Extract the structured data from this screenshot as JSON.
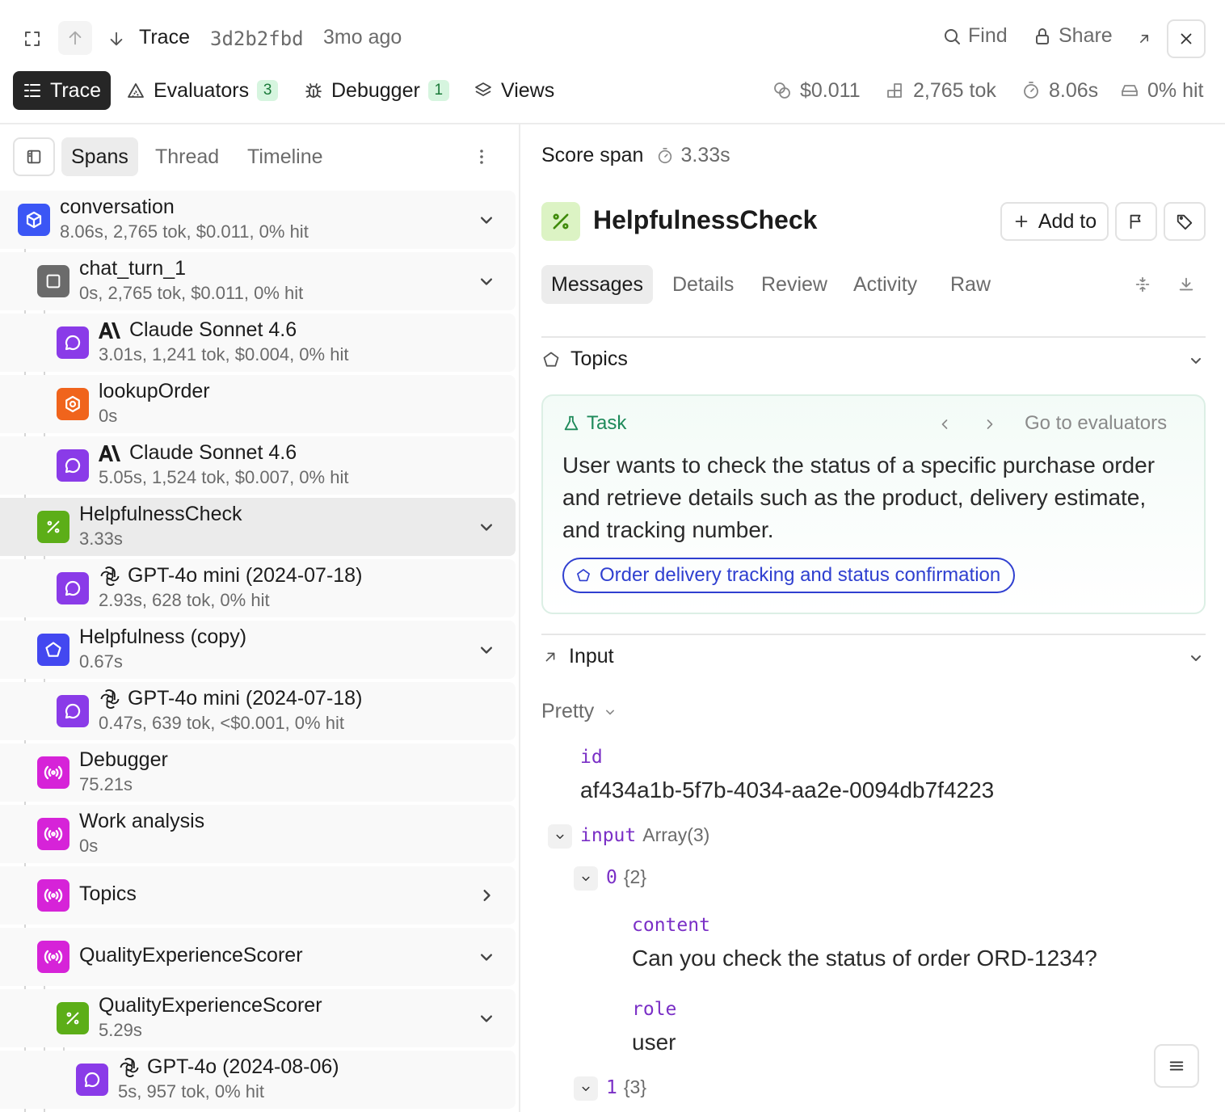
{
  "header": {
    "title": "Trace",
    "trace_id": "3d2b2fbd",
    "age": "3mo ago",
    "find_label": "Find",
    "share_label": "Share"
  },
  "tabs": {
    "trace": "Trace",
    "evaluators": "Evaluators",
    "evaluators_count": "3",
    "debugger": "Debugger",
    "debugger_count": "1",
    "views": "Views"
  },
  "stats": {
    "cost": "$0.011",
    "tokens": "2,765 tok",
    "duration": "8.06s",
    "cache": "0% hit"
  },
  "left_tabs": {
    "spans": "Spans",
    "thread": "Thread",
    "timeline": "Timeline"
  },
  "spans": [
    {
      "name": "conversation",
      "meta": "8.06s, 2,765 tok, $0.011, 0% hit"
    },
    {
      "name": "chat_turn_1",
      "meta": "0s, 2,765 tok, $0.011, 0% hit"
    },
    {
      "name": "Claude Sonnet 4.6",
      "meta": "3.01s, 1,241 tok, $0.004, 0% hit"
    },
    {
      "name": "lookupOrder",
      "meta": "0s"
    },
    {
      "name": "Claude Sonnet 4.6",
      "meta": "5.05s, 1,524 tok, $0.007, 0% hit"
    },
    {
      "name": "HelpfulnessCheck",
      "meta": "3.33s"
    },
    {
      "name": "GPT-4o mini (2024-07-18)",
      "meta": "2.93s, 628 tok, 0% hit"
    },
    {
      "name": "Helpfulness (copy)",
      "meta": "0.67s"
    },
    {
      "name": "GPT-4o mini (2024-07-18)",
      "meta": "0.47s, 639 tok, <$0.001, 0% hit"
    },
    {
      "name": "Debugger",
      "meta": "75.21s"
    },
    {
      "name": "Work analysis",
      "meta": "0s"
    },
    {
      "name": "Topics",
      "meta": ""
    },
    {
      "name": "QualityExperienceScorer",
      "meta": ""
    },
    {
      "name": "QualityExperienceScorer",
      "meta": "5.29s"
    },
    {
      "name": "GPT-4o (2024-08-06)",
      "meta": "5s, 957 tok, 0% hit"
    }
  ],
  "detail": {
    "kind": "Score span",
    "duration": "3.33s",
    "title": "HelpfulnessCheck",
    "add_to": "Add to",
    "tabs": {
      "messages": "Messages",
      "details": "Details",
      "review": "Review",
      "activity": "Activity",
      "raw": "Raw"
    },
    "topics_title": "Topics",
    "task_label": "Task",
    "go_to_evaluators": "Go to evaluators",
    "task_text": "User wants to check the status of a specific purchase order and retrieve details such as the product, delivery estimate, and tracking number.",
    "topic_tag": "Order delivery tracking and status confirmation",
    "input_title": "Input",
    "format": "Pretty",
    "json": {
      "id_key": "id",
      "id_value": "af434a1b-5f7b-4034-aa2e-0094db7f4223",
      "input_key": "input",
      "input_type": "Array(3)",
      "item0_index": "0",
      "item0_count": "{2}",
      "content_key": "content",
      "content_value": "Can you check the status of order ORD-1234?",
      "role_key": "role",
      "role_value": "user",
      "item1_index": "1",
      "item1_count": "{3}"
    }
  },
  "colors": {
    "accent_blue": "#3b56f5",
    "span_gray": "#6b6b6b",
    "llm_purple": "#8a3be8",
    "tool_orange": "#f0641c",
    "score_green": "#5cae18",
    "debug_magenta": "#d623d8",
    "pentagon_indigo": "#4348f0",
    "task_green": "#1e8a5a",
    "tag_blue": "#2f3fd0"
  }
}
